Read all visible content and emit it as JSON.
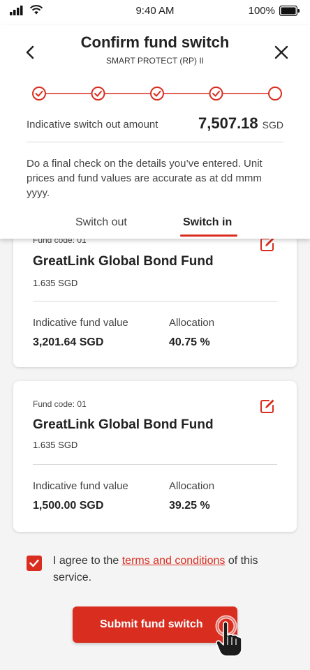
{
  "status_bar": {
    "time": "9:40 AM",
    "battery": "100%"
  },
  "header": {
    "title": "Confirm fund switch",
    "subtitle": "SMART PROTECT (RP) II"
  },
  "stepper": {
    "steps_total": 5,
    "steps_completed": 4
  },
  "summary": {
    "amount_label": "Indicative switch out amount",
    "amount_value": "7,507.18",
    "amount_unit": "SGD",
    "notice": "Do a final check on the details you’ve entered. Unit prices and fund values are accurate as at dd mmm yyyy."
  },
  "tabs": [
    {
      "label": "Switch out",
      "active": false
    },
    {
      "label": "Switch in",
      "active": true
    }
  ],
  "funds": [
    {
      "code": "Fund code: 01",
      "name": "GreatLink Global Bond Fund",
      "price": "1.635 SGD",
      "value_label": "Indicative fund value",
      "value": "3,201.64 SGD",
      "allocation_label": "Allocation",
      "allocation": "40.75 %"
    },
    {
      "code": "Fund code: 01",
      "name": "GreatLink Global Bond Fund",
      "price": "1.635 SGD",
      "value_label": "Indicative fund value",
      "value": "1,500.00 SGD",
      "allocation_label": "Allocation",
      "allocation": "39.25 %"
    }
  ],
  "agreement": {
    "checked": true,
    "text_before": "I agree to the ",
    "link_text": "terms and conditions",
    "text_after": " of this service."
  },
  "submit": {
    "label": "Submit fund switch"
  },
  "colors": {
    "accent": "#d92d20",
    "background": "#f4f4f4",
    "card": "#ffffff"
  },
  "icons": [
    "signal-icon",
    "wifi-icon",
    "battery-icon",
    "back-chevron-icon",
    "close-icon",
    "check-circle-icon",
    "edit-icon",
    "checkmark-icon",
    "tap-hand-icon"
  ]
}
